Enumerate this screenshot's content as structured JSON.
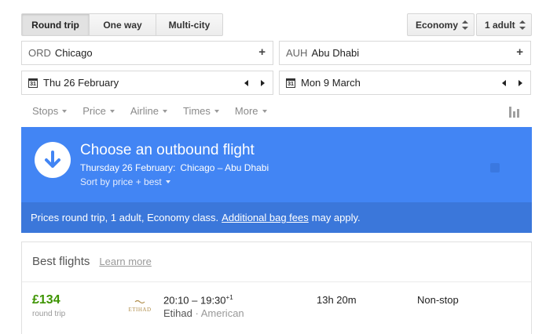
{
  "trip_type": {
    "options": [
      "Round trip",
      "One way",
      "Multi-city"
    ],
    "selected": "Round trip"
  },
  "cabin": {
    "selected": "Economy"
  },
  "passengers": {
    "selected": "1 adult"
  },
  "origin": {
    "code": "ORD",
    "city": "Chicago",
    "add": "+"
  },
  "destination": {
    "code": "AUH",
    "city": "Abu Dhabi",
    "add": "+"
  },
  "departure_date": {
    "calendar_day": "31",
    "value": "Thu 26 February"
  },
  "return_date": {
    "calendar_day": "31",
    "value": "Mon 9 March"
  },
  "filters": [
    "Stops",
    "Price",
    "Airline",
    "Times",
    "More"
  ],
  "banner": {
    "title": "Choose an outbound flight",
    "date": "Thursday 26 February:",
    "route": "Chicago – Abu Dhabi",
    "sort": "Sort by price + best",
    "notice_prefix": "Prices round trip, 1 adult, Economy class.",
    "notice_link": "Additional bag fees",
    "notice_suffix": "may apply.",
    "accent_color": "#4285f4"
  },
  "results": {
    "heading": "Best flights",
    "learn_more": "Learn more",
    "flights": [
      {
        "price": "£134",
        "price_type": "round trip",
        "airline_logo_text": "ETIHAD",
        "times": "20:10 – 19:30",
        "day_offset": "+1",
        "airline": "Etihad",
        "operator_separator": "·",
        "operator": "American",
        "duration": "13h 20m",
        "stops": "Non-stop"
      }
    ]
  },
  "colors": {
    "price_green": "#3d9400",
    "banner_blue": "#4285f4",
    "notice_blue": "#3b77da"
  }
}
